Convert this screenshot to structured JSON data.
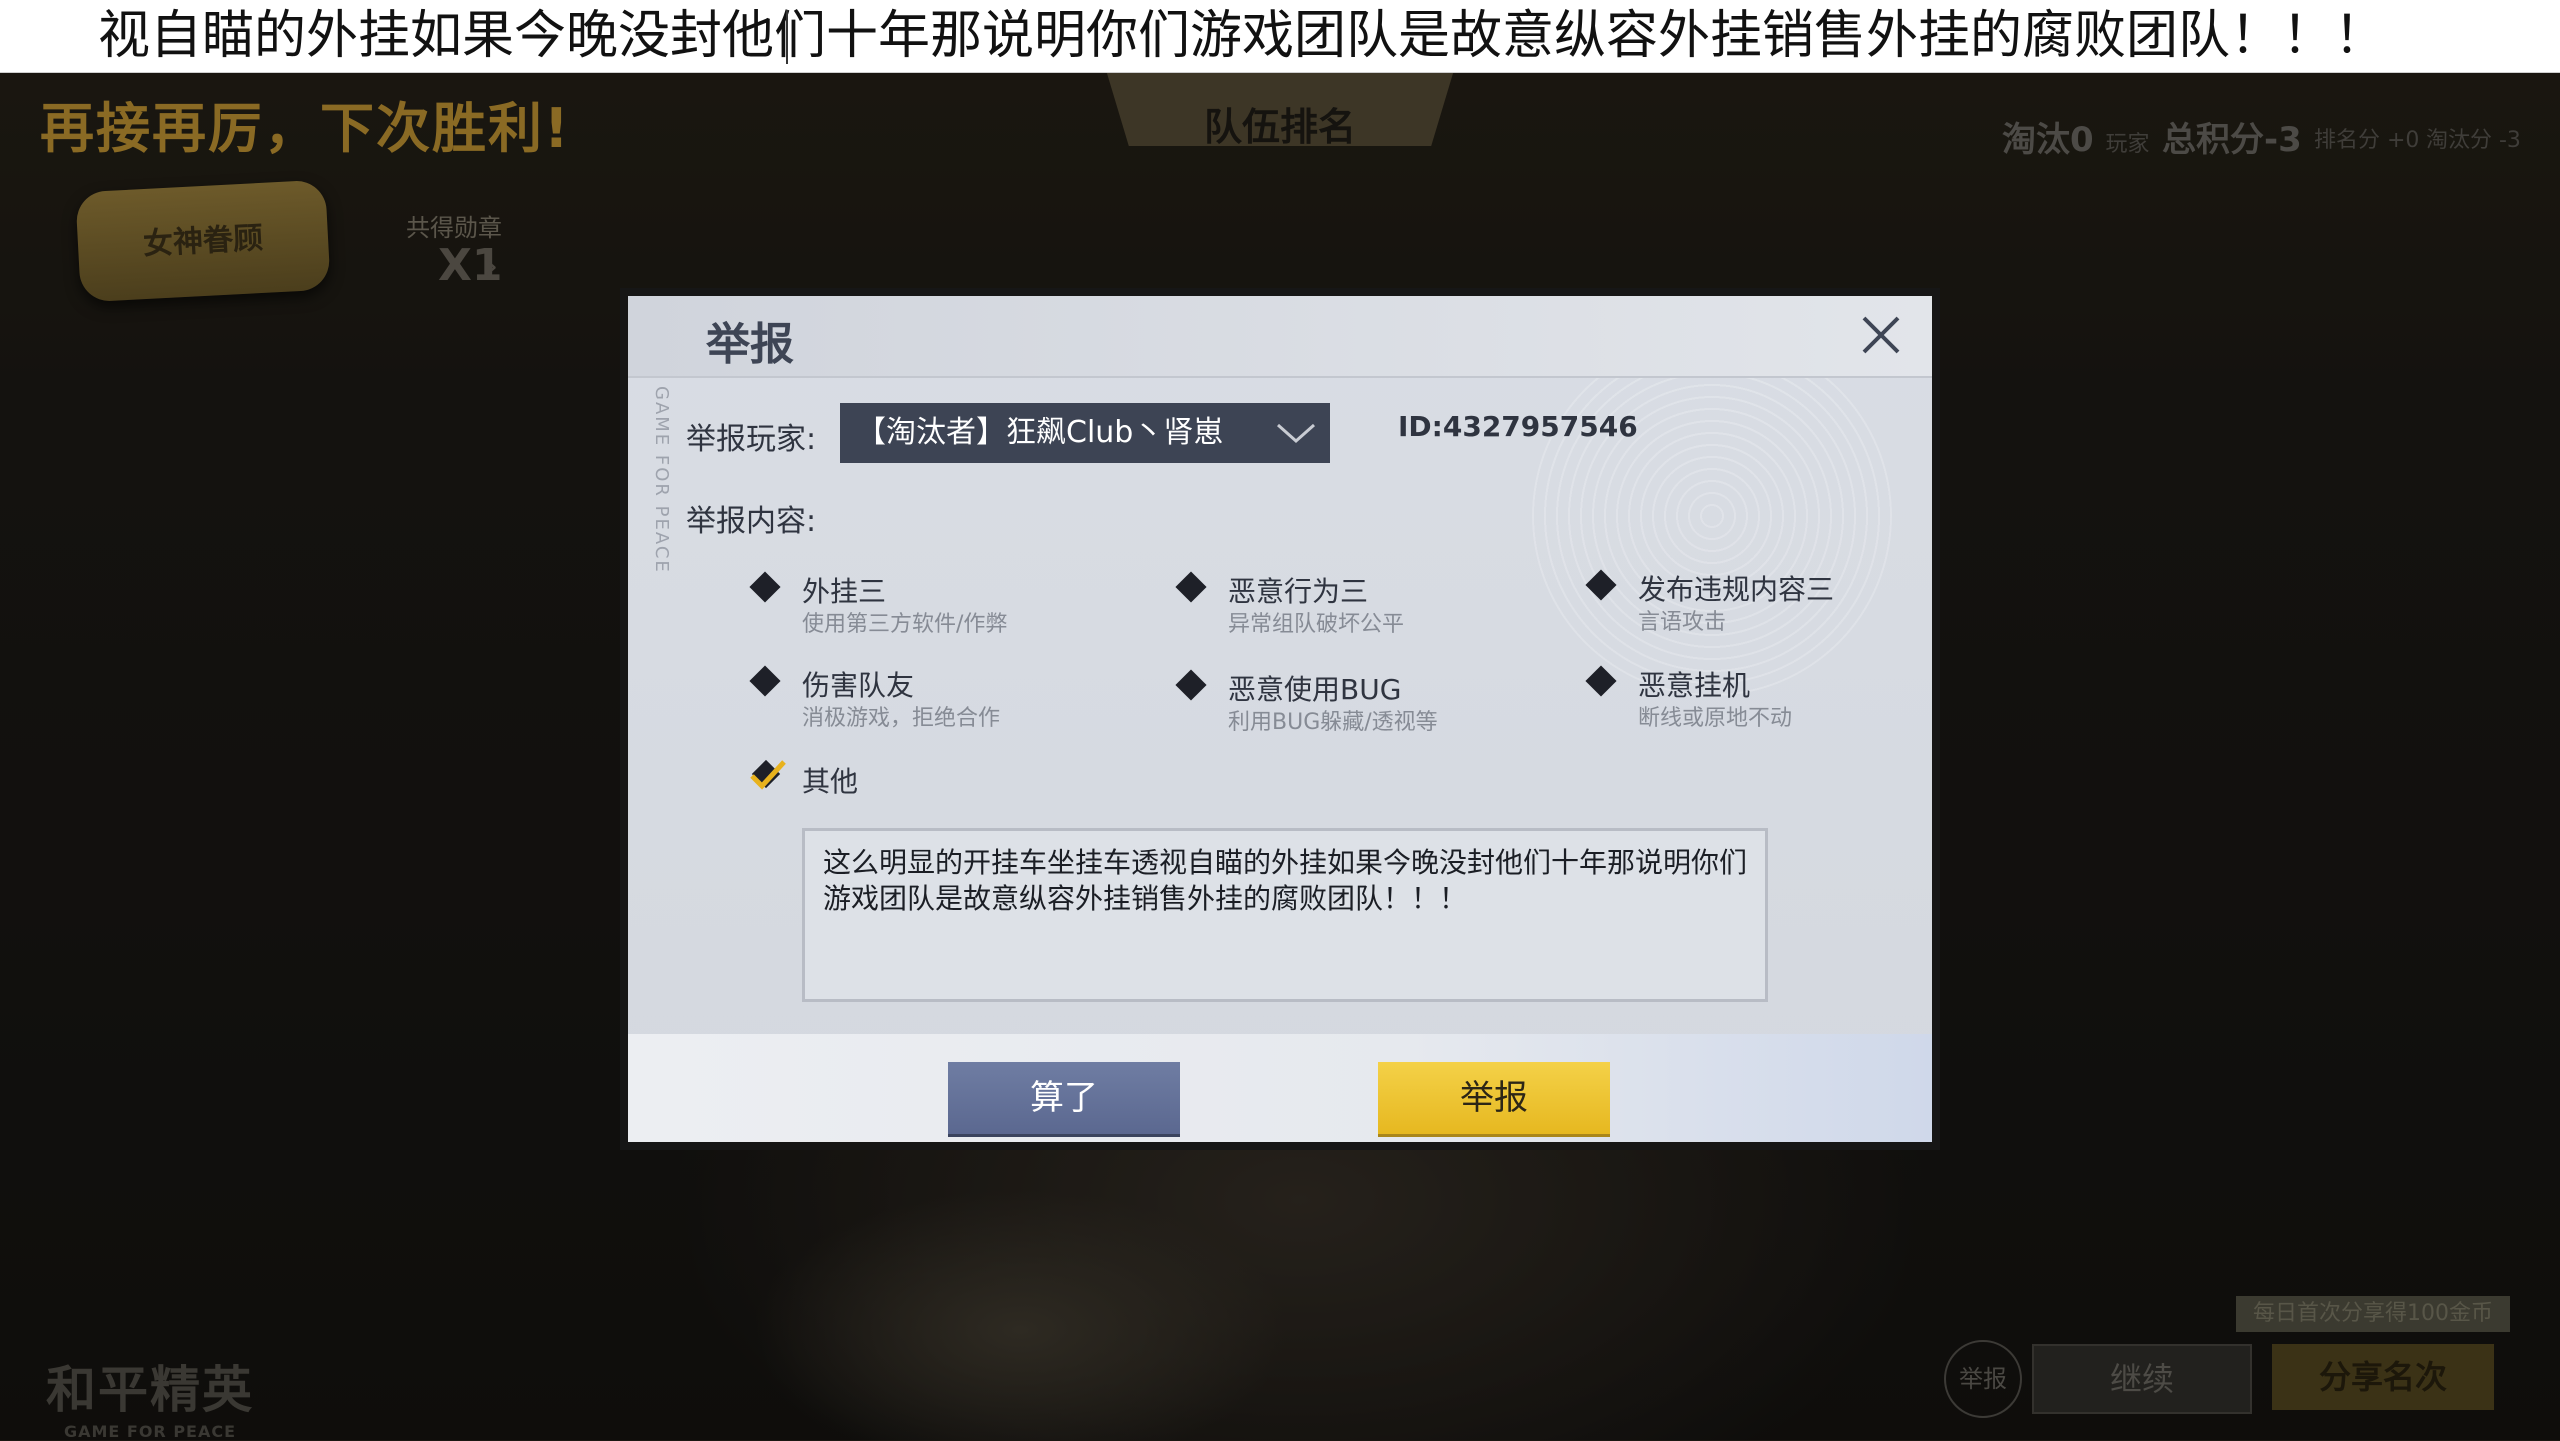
{
  "input_bar": {
    "text": "视自瞄的外挂如果今晚没封他们十年那说明你们游戏团队是故意纵容外挂销售外挂的腐败团队！！！"
  },
  "background": {
    "victory_text": "再接再厉，下次胜利!",
    "badge_label": "女神眷顾",
    "medal_label": "共得勋章",
    "medal_count": "X1",
    "header_plaque": "队伍排名",
    "eliminated_label": "淘汰",
    "eliminated_value": "0",
    "eliminated_unit": "玩家",
    "total_score_label": "总积分",
    "total_score_value": "-3",
    "rank_score": "排名分 +0",
    "elim_score": "淘汰分 -3",
    "bonus_tag": "每日首次分享得100金币",
    "report_circle": "举报",
    "continue_button": "继续",
    "share_button": "分享名次",
    "logo_main": "和平精英",
    "logo_sub": "GAME FOR PEACE"
  },
  "dialog": {
    "title": "举报",
    "side_text": "GAME FOR PEACE",
    "player_label": "举报玩家:",
    "player_selected": "【淘汰者】狂飙Club丶肾崽",
    "player_id": "ID:4327957546",
    "content_label": "举报内容:",
    "options": [
      {
        "title": "外挂三",
        "desc": "使用第三方软件/作弊",
        "checked": false
      },
      {
        "title": "恶意行为三",
        "desc": "异常组队破坏公平",
        "checked": false
      },
      {
        "title": "发布违规内容三",
        "desc": "言语攻击",
        "checked": false
      },
      {
        "title": "伤害队友",
        "desc": "消极游戏，拒绝合作",
        "checked": false
      },
      {
        "title": "恶意使用BUG",
        "desc": "利用BUG躲藏/透视等",
        "checked": false
      },
      {
        "title": "恶意挂机",
        "desc": "断线或原地不动",
        "checked": false
      },
      {
        "title": "其他",
        "desc": "",
        "checked": true
      }
    ],
    "textarea_value": "这么明显的开挂车坐挂车透视自瞄的外挂如果今晚没封他们十年那说明你们游戏团队是故意纵容外挂销售外挂的腐败团队！！！",
    "cancel_button": "算了",
    "report_button": "举报"
  },
  "colors": {
    "report_button": "#f4d148",
    "cancel_button": "#6f7da3",
    "dropdown": "#3d4454"
  }
}
